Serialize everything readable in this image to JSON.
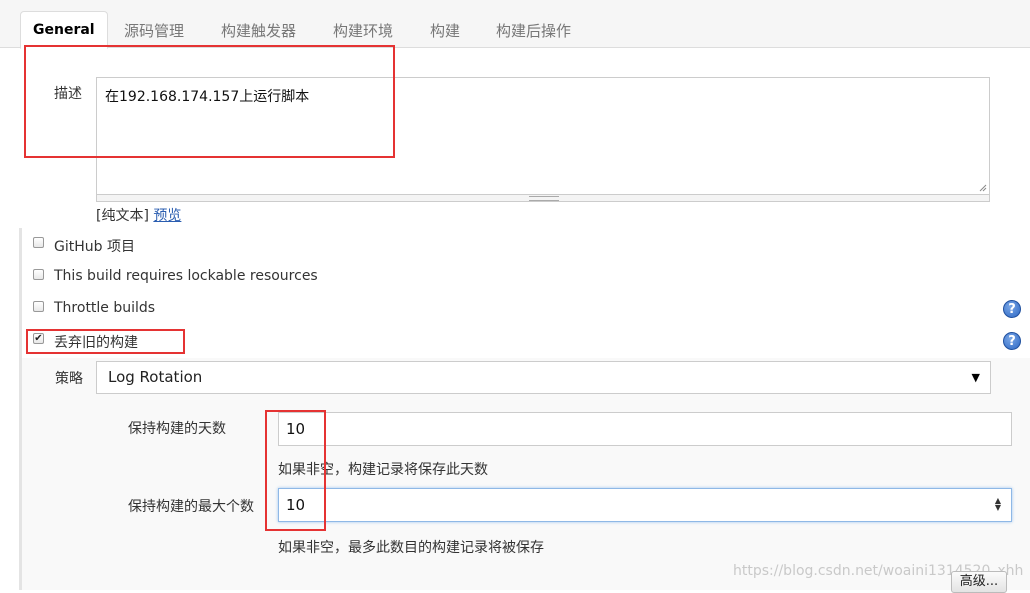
{
  "tabs": [
    {
      "label": "General"
    },
    {
      "label": "源码管理"
    },
    {
      "label": "构建触发器"
    },
    {
      "label": "构建环境"
    },
    {
      "label": "构建"
    },
    {
      "label": "构建后操作"
    }
  ],
  "description": {
    "label": "描述",
    "value": "在192.168.174.157上运行脚本",
    "format_prefix": "[纯文本]",
    "preview_link": "预览"
  },
  "options": [
    {
      "label": "GitHub 项目",
      "checked": false
    },
    {
      "label": "This build requires lockable resources",
      "checked": false
    },
    {
      "label": "Throttle builds",
      "checked": false
    },
    {
      "label": "丢弃旧的构建",
      "checked": true
    }
  ],
  "strategy": {
    "label": "策略",
    "selected": "Log Rotation"
  },
  "days_to_keep": {
    "label": "保持构建的天数",
    "value": "10",
    "hint": "如果非空，构建记录将保存此天数"
  },
  "max_builds": {
    "label": "保持构建的最大个数",
    "value": "10",
    "hint": "如果非空，最多此数目的构建记录将被保存"
  },
  "advanced_button": "高级...",
  "watermark": "https://blog.csdn.net/woaini1314520_xhh",
  "help_icon_glyph": "?",
  "colors": {
    "highlight_red": "#e53333",
    "link_blue": "#2a5db0",
    "help_blue": "#2c67c4"
  }
}
